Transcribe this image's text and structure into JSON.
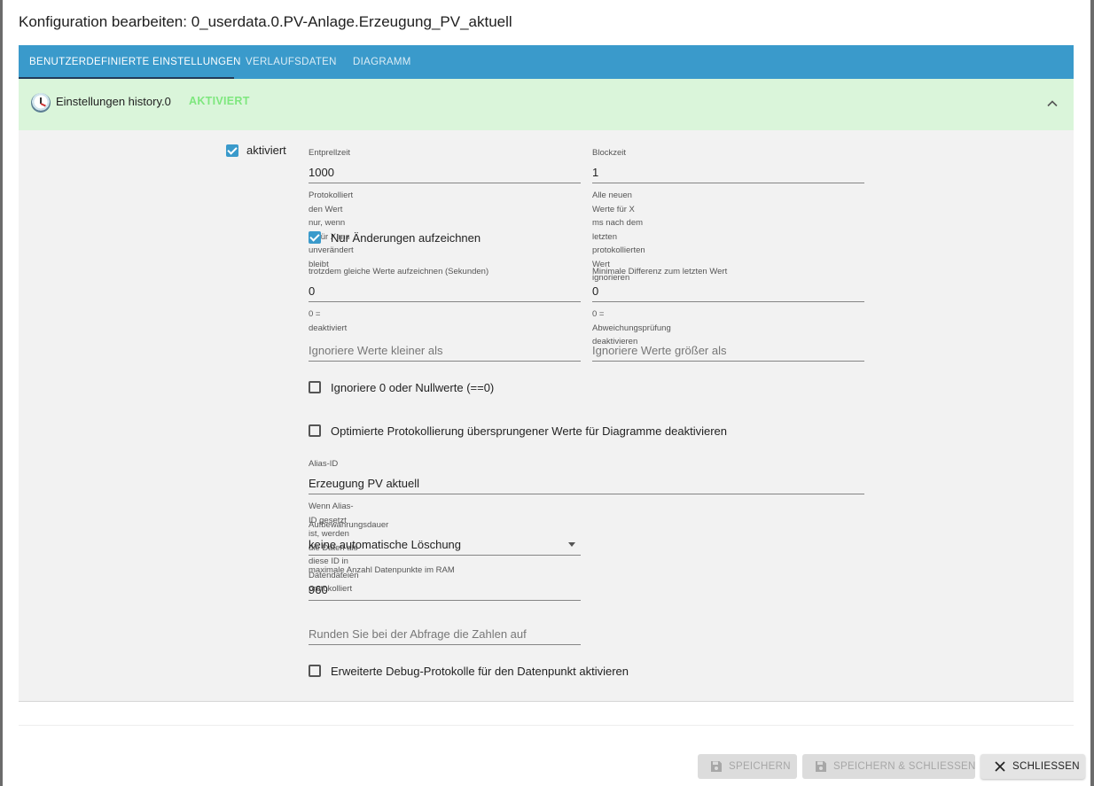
{
  "dialog": {
    "title": "Konfiguration bearbeiten: 0_userdata.0.PV-Anlage.Erzeugung_PV_aktuell"
  },
  "tabs": [
    {
      "label": "BENUTZERDEFINIERTE EINSTELLUNGEN",
      "active": true
    },
    {
      "label": "VERLAUFSDATEN",
      "active": false
    },
    {
      "label": "DIAGRAMM",
      "active": false
    }
  ],
  "colors": {
    "accent": "#3a9acb",
    "header_bg": "#daf5da",
    "status_green": "#7ee77e"
  },
  "panel": {
    "icon": "history-icon",
    "title": "Einstellungen history.0",
    "status": "AKTIVIERT",
    "collapse_icon": "chevron-up-icon"
  },
  "settings": {
    "enabled": {
      "label": "aktiviert",
      "checked": true
    },
    "debounce": {
      "label": "Entprellzeit",
      "value": "1000",
      "help": "Protokolliert den Wert nur, wenn er für X ms unverändert bleibt"
    },
    "blocktime": {
      "label": "Blockzeit",
      "value": "1",
      "help_line1": "Alle neuen Werte für X ms nach dem letzten protokollierten Wert",
      "help_line2": "ignorieren"
    },
    "changes_only": {
      "label": "Nur Änderungen aufzeichnen",
      "checked": true
    },
    "changes_relog": {
      "label": "trotzdem gleiche Werte aufzeichnen (Sekunden)",
      "value": "0",
      "help": "0 = deaktiviert"
    },
    "min_diff": {
      "label": "Minimale Differenz zum letzten Wert",
      "value": "0",
      "help": "0 = Abweichungsprüfung deaktivieren"
    },
    "ignore_below": {
      "placeholder": "Ignoriere Werte kleiner als"
    },
    "ignore_above": {
      "placeholder": "Ignoriere Werte größer als"
    },
    "ignore_zero": {
      "label": "Ignoriere 0 oder Nullwerte (==0)",
      "checked": false
    },
    "disable_skipped": {
      "label": "Optimierte Protokollierung übersprungener Werte für Diagramme deaktivieren",
      "checked": false
    },
    "alias_id": {
      "label": "Alias-ID",
      "value": "Erzeugung PV aktuell",
      "help": "Wenn Alias-ID gesetzt ist, werden die Daten als diese ID in Datendateien protokolliert"
    },
    "retention": {
      "label": "Aufbewahrungsdauer",
      "value": "keine automatische Löschung"
    },
    "max_length": {
      "label": "maximale Anzahl Datenpunkte im RAM",
      "value": "960"
    },
    "round": {
      "placeholder": "Runden Sie bei der Abfrage die Zahlen auf"
    },
    "debug": {
      "label": "Erweiterte Debug-Protokolle für den Datenpunkt aktivieren",
      "checked": false
    }
  },
  "footer": {
    "save": {
      "label": "SPEICHERN",
      "icon": "save-icon",
      "disabled": true
    },
    "save_close": {
      "label": "SPEICHERN & SCHLIESSEN",
      "icon": "save-icon",
      "disabled": true
    },
    "close": {
      "label": "SCHLIESSEN",
      "icon": "close-icon",
      "disabled": false
    }
  }
}
